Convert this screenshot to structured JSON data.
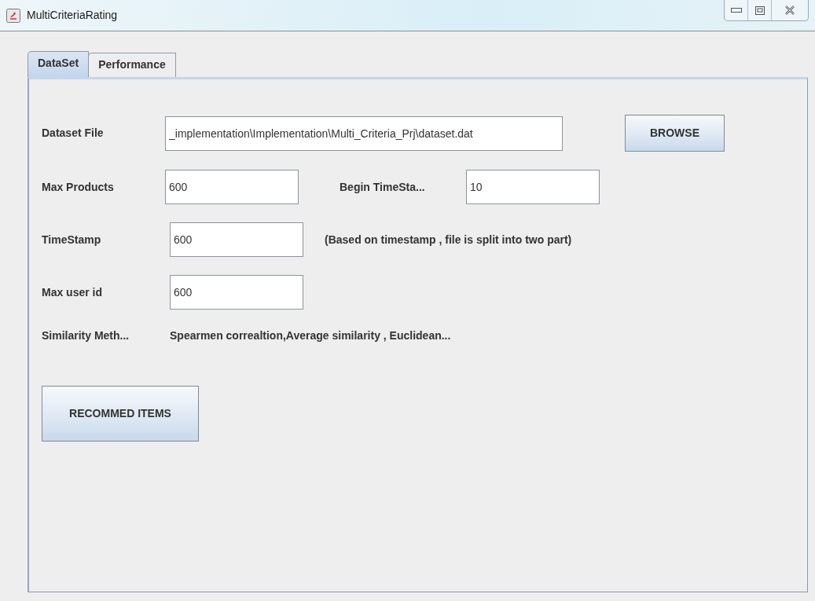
{
  "window": {
    "title": "MultiCriteriaRating"
  },
  "tabs": [
    {
      "label": "DataSet",
      "selected": true
    },
    {
      "label": "Performance",
      "selected": false
    }
  ],
  "rows": [
    {
      "kind": "file",
      "label": "Dataset File",
      "value": "_implementation\\Implementation\\Multi_Criteria_Prj\\dataset.dat",
      "button": "BROWSE"
    },
    {
      "kind": "pair",
      "label": "Max Products",
      "value": "600",
      "label2": "Begin TimeSta...",
      "value2": "10"
    },
    {
      "kind": "note",
      "label": "TimeStamp",
      "value": "600",
      "note": "(Based on timestamp , file is split into two part)"
    },
    {
      "kind": "field",
      "label": "Max user id",
      "value": "600"
    },
    {
      "kind": "text",
      "label": "Similarity Meth...",
      "text": "Spearmen correaltion,Average similarity , Euclidean..."
    }
  ],
  "action_button": "RECOMMED ITEMS"
}
